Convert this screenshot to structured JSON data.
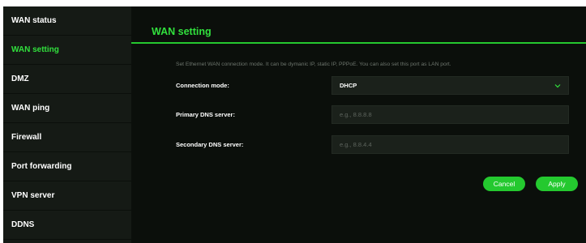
{
  "sidebar": {
    "items": [
      {
        "label": "WAN status",
        "active": false
      },
      {
        "label": "WAN setting",
        "active": true
      },
      {
        "label": "DMZ",
        "active": false
      },
      {
        "label": "WAN ping",
        "active": false
      },
      {
        "label": "Firewall",
        "active": false
      },
      {
        "label": "Port forwarding",
        "active": false
      },
      {
        "label": "VPN server",
        "active": false
      },
      {
        "label": "DDNS",
        "active": false
      }
    ]
  },
  "main": {
    "title": "WAN setting",
    "description": "Set Ethernet WAN connection mode. It can be dymanic IP, static IP, PPPoE. You can also set this port as LAN port.",
    "connection_mode": {
      "label": "Connection mode:",
      "value": "DHCP",
      "icon": "chevron-down-icon"
    },
    "primary_dns": {
      "label": "Primary DNS server:",
      "value": "",
      "placeholder": "e.g., 8.8.8.8"
    },
    "secondary_dns": {
      "label": "Secondary DNS server:",
      "value": "",
      "placeholder": "e.g., 8.8.4.4"
    },
    "buttons": {
      "cancel": "Cancel",
      "apply": "Apply"
    }
  },
  "colors": {
    "accent": "#31e03d",
    "background": "#0b0f0b",
    "sidebar": "#151a15",
    "field": "#1b211b"
  }
}
